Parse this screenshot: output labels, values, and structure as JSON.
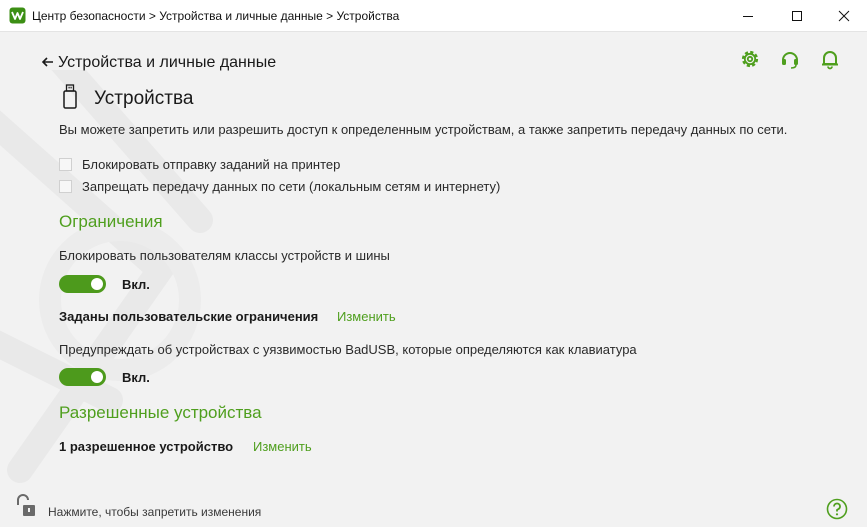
{
  "window": {
    "breadcrumb": "Центр безопасности > Устройства и личные данные > Устройства",
    "brand_color": "#4f9f1e",
    "controls": [
      "minimize-icon",
      "maximize-icon",
      "close-icon"
    ]
  },
  "header": {
    "back_label": "Устройства и личные данные",
    "icons": [
      "gear-icon",
      "headset-icon",
      "bell-icon"
    ]
  },
  "page": {
    "icon": "usb-drive-icon",
    "title": "Устройства",
    "description": "Вы можете запретить или разрешить доступ к определенным устройствам, а также запретить передачу данных по сети."
  },
  "options": [
    {
      "label": "Блокировать отправку заданий на принтер",
      "checked": false
    },
    {
      "label": "Запрещать передачу данных по сети (локальным сетям и интернету)",
      "checked": false
    }
  ],
  "restrictions": {
    "title": "Ограничения",
    "block_label": "Блокировать пользователям классы устройств и шины",
    "block_toggle": {
      "state": "Вкл.",
      "on": true
    },
    "custom_label": "Заданы пользовательские ограничения",
    "custom_link": "Изменить",
    "badusb_label": "Предупреждать об устройствах с уязвимостью BadUSB, которые определяются как клавиатура",
    "badusb_toggle": {
      "state": "Вкл.",
      "on": true
    }
  },
  "allowed": {
    "title": "Разрешенные устройства",
    "count_label": "1 разрешенное устройство",
    "link": "Изменить"
  },
  "footer": {
    "lock_text": "Нажмите, чтобы запретить изменения",
    "icons": [
      "unlocked-padlock-icon",
      "help-icon"
    ]
  }
}
